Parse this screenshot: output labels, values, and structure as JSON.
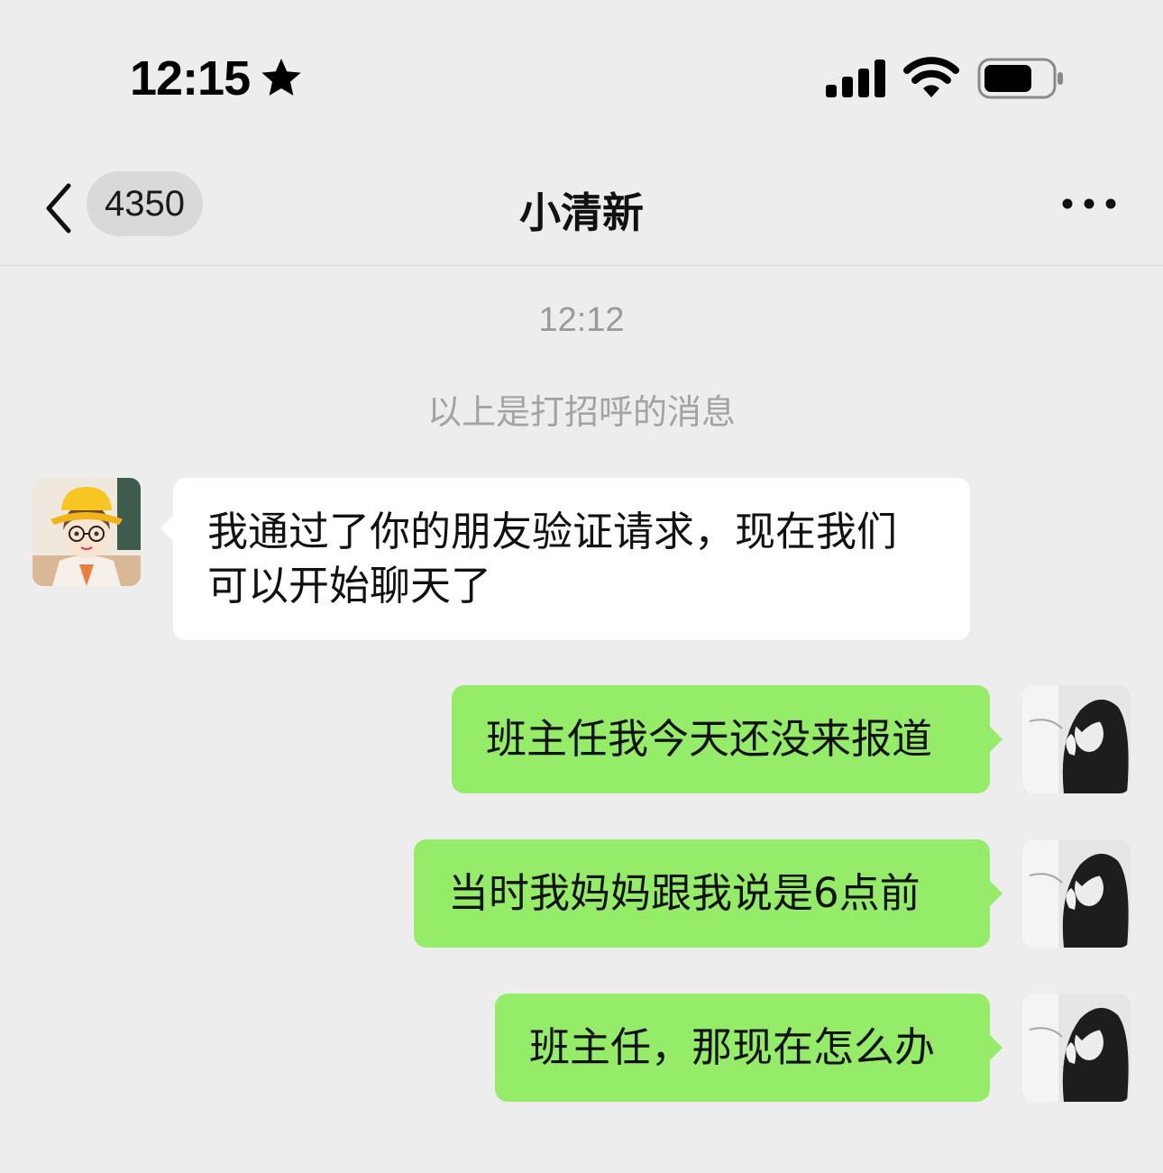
{
  "status_bar": {
    "time": "12:15",
    "icons": [
      "star-icon",
      "signal-icon",
      "wifi-icon",
      "battery-icon"
    ]
  },
  "nav": {
    "unread_count": "4350",
    "title": "小清新",
    "back_icon": "chevron-left-icon",
    "more_icon": "more-dots-icon"
  },
  "conversation": {
    "timestamp": "12:12",
    "system_note": "以上是打招呼的消息",
    "messages": [
      {
        "direction": "incoming",
        "text": "我通过了你的朋友验证请求，现在我们可以开始聊天了"
      },
      {
        "direction": "outgoing",
        "text": "班主任我今天还没来报道"
      },
      {
        "direction": "outgoing",
        "text": "当时我妈妈跟我说是6点前"
      },
      {
        "direction": "outgoing",
        "text": "班主任，那现在怎么办"
      }
    ]
  },
  "colors": {
    "background": "#ededed",
    "incoming_bubble": "#ffffff",
    "outgoing_bubble": "#95ec69",
    "badge": "#d9d9d9"
  }
}
